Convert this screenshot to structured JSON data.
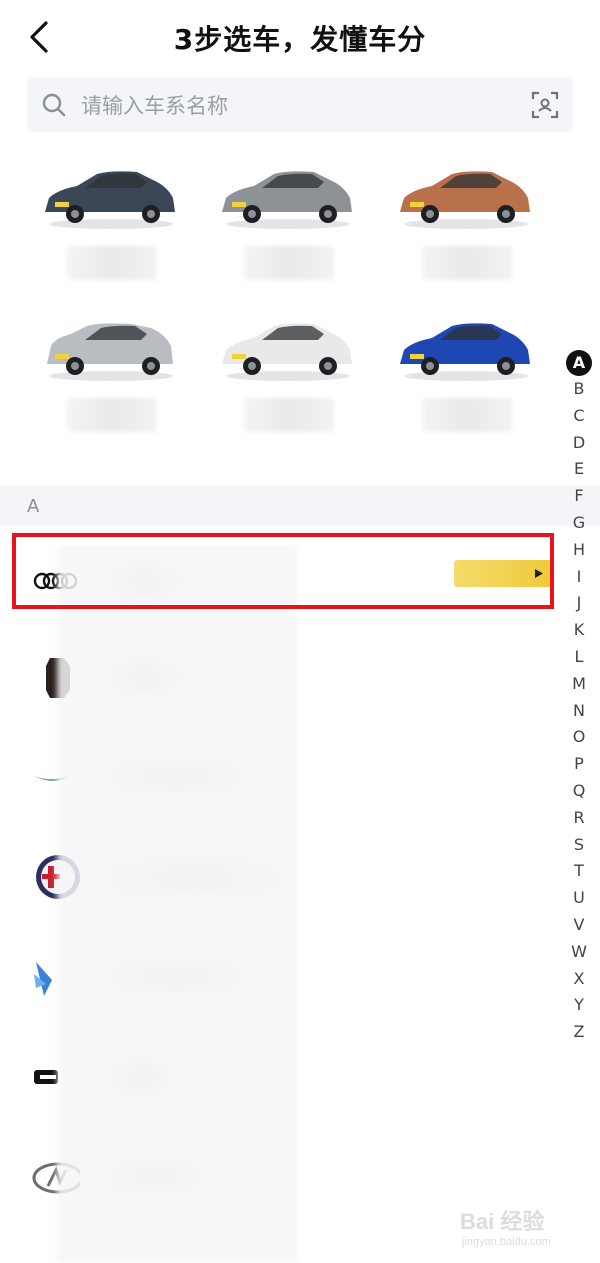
{
  "header": {
    "title": "3步选车，发懂车分"
  },
  "search": {
    "placeholder": "请输入车系名称"
  },
  "section": {
    "letter": "A"
  },
  "index_letters": [
    "A",
    "B",
    "C",
    "D",
    "E",
    "F",
    "G",
    "H",
    "I",
    "J",
    "K",
    "L",
    "M",
    "N",
    "O",
    "P",
    "Q",
    "R",
    "S",
    "T",
    "U",
    "V",
    "W",
    "X",
    "Y",
    "Z"
  ],
  "index_active": "A",
  "cars": [
    {
      "icon": "dark-blue-sedan-icon",
      "color": "#3b4756"
    },
    {
      "icon": "silver-sedan-icon",
      "color": "#8d9296"
    },
    {
      "icon": "orange-sedan-icon",
      "color": "#b8714a"
    },
    {
      "icon": "silver-suv-icon",
      "color": "#b9bcc0"
    },
    {
      "icon": "white-sedan-icon",
      "color": "#e9e9ea"
    },
    {
      "icon": "blue-sedan-icon",
      "color": "#1f47b3"
    }
  ],
  "brands": [
    {
      "logo": "audi-rings-icon"
    },
    {
      "logo": "brand-logo-icon"
    },
    {
      "logo": "aston-martin-wings-icon"
    },
    {
      "logo": "alfa-romeo-badge-icon"
    },
    {
      "logo": "blue-wing-logo-icon"
    },
    {
      "logo": "black-arrow-logo-icon"
    },
    {
      "logo": "oval-letter-logo-icon"
    }
  ],
  "accent": {
    "highlight": "#e8141b",
    "promo": "#f0c93c"
  },
  "watermark": {
    "brand": "Bai 经验",
    "url": "jingyan.baidu.com"
  }
}
